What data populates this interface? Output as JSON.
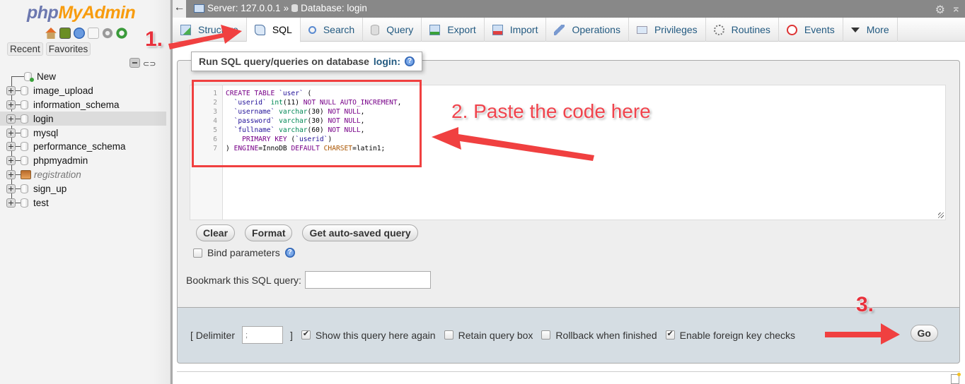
{
  "sidebar": {
    "logo": {
      "php": "php",
      "myadmin": "MyAdmin"
    },
    "nav_icons": [
      "home-icon",
      "logout-icon",
      "help-icon",
      "docs-icon",
      "settings-icon",
      "reload-icon"
    ],
    "buttons": {
      "recent": "Recent",
      "favorites": "Favorites"
    },
    "tree": [
      {
        "label": "New",
        "kind": "new"
      },
      {
        "label": "image_upload",
        "kind": "db"
      },
      {
        "label": "information_schema",
        "kind": "db"
      },
      {
        "label": "login",
        "kind": "db",
        "active": true
      },
      {
        "label": "mysql",
        "kind": "db"
      },
      {
        "label": "performance_schema",
        "kind": "db"
      },
      {
        "label": "phpmyadmin",
        "kind": "db"
      },
      {
        "label": "registration",
        "kind": "db-italic"
      },
      {
        "label": "sign_up",
        "kind": "db"
      },
      {
        "label": "test",
        "kind": "db"
      }
    ]
  },
  "topbar": {
    "back": "←",
    "server": "Server: 127.0.0.1",
    "separator": "»",
    "database": "Database: login"
  },
  "tabs": [
    {
      "label": "Structure",
      "icon": "structure-icon"
    },
    {
      "label": "SQL",
      "icon": "sql-icon",
      "active": true
    },
    {
      "label": "Search",
      "icon": "search-icon"
    },
    {
      "label": "Query",
      "icon": "query-icon"
    },
    {
      "label": "Export",
      "icon": "export-icon"
    },
    {
      "label": "Import",
      "icon": "import-icon"
    },
    {
      "label": "Operations",
      "icon": "operations-icon"
    },
    {
      "label": "Privileges",
      "icon": "privileges-icon"
    },
    {
      "label": "Routines",
      "icon": "routines-icon"
    },
    {
      "label": "Events",
      "icon": "events-icon"
    },
    {
      "label": "More",
      "icon": "more-icon"
    }
  ],
  "main": {
    "legend_prefix": "Run SQL query/queries on database",
    "legend_db": "login:",
    "help": "?",
    "sql_lines": [
      "CREATE TABLE `user` (",
      "  `userid` int(11) NOT NULL AUTO_INCREMENT,",
      "  `username` varchar(30) NOT NULL,",
      "  `password` varchar(30) NOT NULL,",
      "  `fullname` varchar(60) NOT NULL,",
      "    PRIMARY KEY (`userid`)",
      ") ENGINE=InnoDB DEFAULT CHARSET=latin1;"
    ],
    "buttons": {
      "clear": "Clear",
      "format": "Format",
      "autosaved": "Get auto-saved query"
    },
    "bind_parameters": {
      "label": "Bind parameters",
      "checked": false
    },
    "bookmark_label": "Bookmark this SQL query:",
    "bookmark_value": ""
  },
  "options": {
    "delimiter_open": "[ Delimiter",
    "delimiter_value": ";",
    "delimiter_close": "]",
    "checks": [
      {
        "label": "Show this query here again",
        "checked": true
      },
      {
        "label": "Retain query box",
        "checked": false
      },
      {
        "label": "Rollback when finished",
        "checked": false
      },
      {
        "label": "Enable foreign key checks",
        "checked": true
      }
    ],
    "go": "Go"
  },
  "annotations": {
    "step1": "1.",
    "step2": "2. Paste the code here",
    "step3": "3.",
    "color": "#f04040"
  }
}
